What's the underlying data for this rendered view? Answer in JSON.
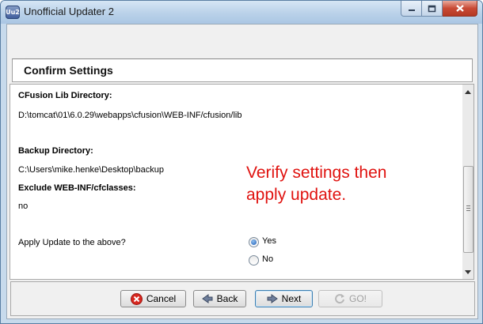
{
  "window": {
    "title": "Unofficial Updater 2",
    "app_icon_text": "Uu2"
  },
  "header": {
    "title": "Confirm Settings"
  },
  "settings": {
    "lib_dir_label": "CFusion Lib Directory:",
    "lib_dir_value": "D:\\tomcat\\01\\6.0.29\\webapps\\cfusion\\WEB-INF/cfusion/lib",
    "backup_dir_label": "Backup Directory:",
    "backup_dir_value": "C:\\Users\\mike.henke\\Desktop\\backup",
    "exclude_label": "Exclude WEB-INF/cfclasses:",
    "exclude_value": "no",
    "apply_question": "Apply Update to the above?",
    "yes_label": "Yes",
    "no_label": "No",
    "apply_selected": "Yes"
  },
  "annotation": {
    "line1": "Verify settings then",
    "line2": "apply update."
  },
  "buttons": {
    "cancel": "Cancel",
    "back": "Back",
    "next": "Next",
    "go": "GO!"
  },
  "icons": {
    "cancel": "cancel-icon",
    "back": "back-arrow-icon",
    "next": "next-arrow-icon",
    "go": "go-refresh-icon",
    "minimize": "minimize-icon",
    "maximize": "maximize-icon",
    "close": "close-icon"
  },
  "colors": {
    "annotation": "#e0120f",
    "cancel_icon": "#d8271f",
    "radio_selected": "#1d5ab4"
  }
}
